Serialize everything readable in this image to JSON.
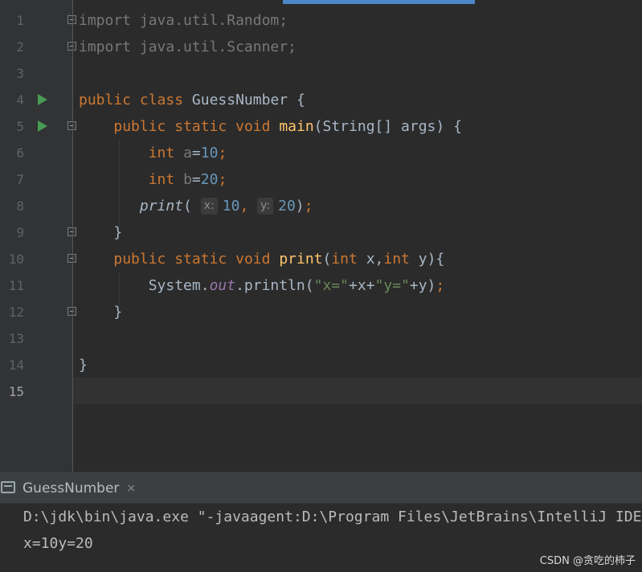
{
  "editor": {
    "line_numbers": [
      "1",
      "2",
      "3",
      "4",
      "5",
      "6",
      "7",
      "8",
      "9",
      "10",
      "11",
      "12",
      "13",
      "14",
      "15"
    ],
    "lines": {
      "l1": {
        "kw": "import",
        "rest": " java.util.Random;"
      },
      "l2": {
        "kw": "import",
        "rest": " java.util.Scanner;"
      },
      "l4": {
        "kw1": "public",
        "kw2": "class",
        "name": "GuessNumber",
        "brace": "{"
      },
      "l5": {
        "kw1": "public",
        "kw2": "static",
        "kw3": "void",
        "fn": "main",
        "params": "(String[] args) {"
      },
      "l6": {
        "type": "int",
        "var": "a",
        "eq": "=",
        "val": "10",
        "semi": ";"
      },
      "l7": {
        "type": "int",
        "var": "b",
        "eq": "=",
        "val": "20",
        "semi": ";"
      },
      "l8": {
        "call": "print",
        "open": "(",
        "hint_x": "x:",
        "arg1": "10",
        "comma": ",",
        "hint_y": "y:",
        "arg2": "20",
        "close": ")",
        "semi": ";"
      },
      "l9": {
        "brace": "}"
      },
      "l10": {
        "kw1": "public",
        "kw2": "static",
        "kw3": "void",
        "fn": "print",
        "open": "(",
        "t1": "int",
        "p1": " x,",
        "t2": "int",
        "p2": " y){"
      },
      "l11": {
        "obj": "System.",
        "field": "out",
        "method": ".println(",
        "s1": "\"x=\"",
        "plus1": "+x+",
        "s2": "\"y=\"",
        "rest": "+y)",
        "semi": ";"
      },
      "l12": {
        "brace": "}"
      },
      "l14": {
        "brace": "}"
      }
    }
  },
  "run_panel": {
    "tab_label": "GuessNumber",
    "close_glyph": "×",
    "console_icon": "console-icon",
    "output": [
      "D:\\jdk\\bin\\java.exe \"-javaagent:D:\\Program Files\\JetBrains\\IntelliJ IDEA",
      "x=10y=20"
    ]
  },
  "watermark": "CSDN @贪吃的柿子",
  "colors": {
    "background": "#2b2b2b",
    "keyword": "#cc7832",
    "function": "#ffc66d",
    "number": "#6897bb",
    "string": "#6a8759",
    "field": "#9876aa",
    "run_icon": "#499c54"
  }
}
